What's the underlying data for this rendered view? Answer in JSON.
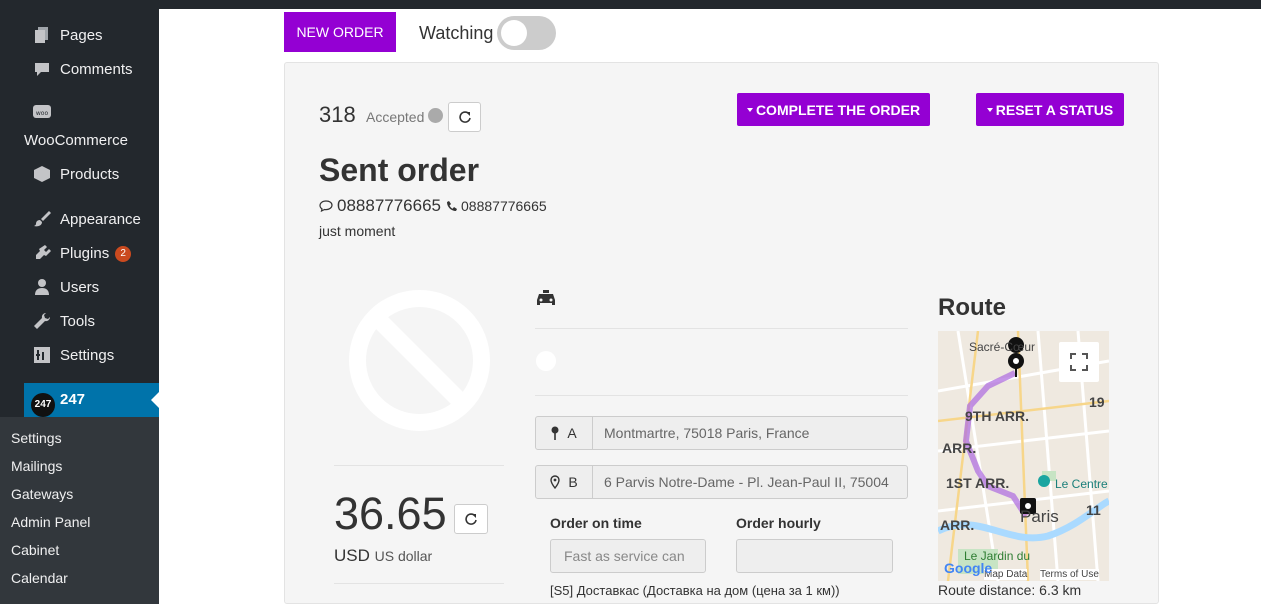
{
  "sidebar": {
    "items": [
      {
        "label": "Pages",
        "icon": "pages-icon"
      },
      {
        "label": "Comments",
        "icon": "comments-icon"
      },
      {
        "label": "WooCommerce",
        "icon": "woocommerce-icon"
      },
      {
        "label": "Products",
        "icon": "products-icon"
      },
      {
        "label": "Appearance",
        "icon": "appearance-icon"
      },
      {
        "label": "Plugins",
        "icon": "plugins-icon",
        "badge": "2"
      },
      {
        "label": "Users",
        "icon": "users-icon"
      },
      {
        "label": "Tools",
        "icon": "tools-icon"
      },
      {
        "label": "Settings",
        "icon": "settings-icon"
      }
    ],
    "active": {
      "label": "247",
      "avatar": "247"
    },
    "submenu": [
      "Settings",
      "Mailings",
      "Gateways",
      "Admin Panel",
      "Cabinet",
      "Calendar"
    ]
  },
  "toolbar": {
    "new_order_label": "NEW ORDER",
    "watching_label": "Watching",
    "watching_on": false
  },
  "order": {
    "number": "318",
    "status": "Accepted",
    "complete_label": "COMPLETE THE ORDER",
    "reset_label": "RESET A STATUS",
    "title": "Sent order",
    "phone_main": "08887776665",
    "phone_alt": "08887776665",
    "note": "just moment",
    "price": "36.65",
    "currency_code": "USD",
    "currency_name": "US dollar",
    "point_a_label": "A",
    "point_a": "Montmartre, 75018 Paris, France",
    "point_b_label": "B",
    "point_b": "6 Parvis Notre-Dame - Pl. Jean-Paul II, 75004",
    "order_on_time_label": "Order on time",
    "order_on_time_placeholder": "Fast as service can",
    "order_hourly_label": "Order hourly",
    "order_hourly_value": "",
    "service_line": "[S5] Доставкас (Доставка на дом (цена за 1 км))"
  },
  "route": {
    "title": "Route",
    "distance": "Route distance: 6.3 km",
    "map_labels": [
      "Sacré-Cœur",
      "9TH ARR.",
      "ARR.",
      "1ST ARR.",
      "Le Centre",
      "Paris",
      "ARR.",
      "11",
      "19",
      "Le Jardin du",
      "Map Data",
      "Terms of Use",
      "Google"
    ]
  },
  "colors": {
    "accent": "#9400d3",
    "sidebar_bg": "#23282d",
    "sidebar_active": "#0073aa",
    "badge": "#ca4a1f"
  }
}
